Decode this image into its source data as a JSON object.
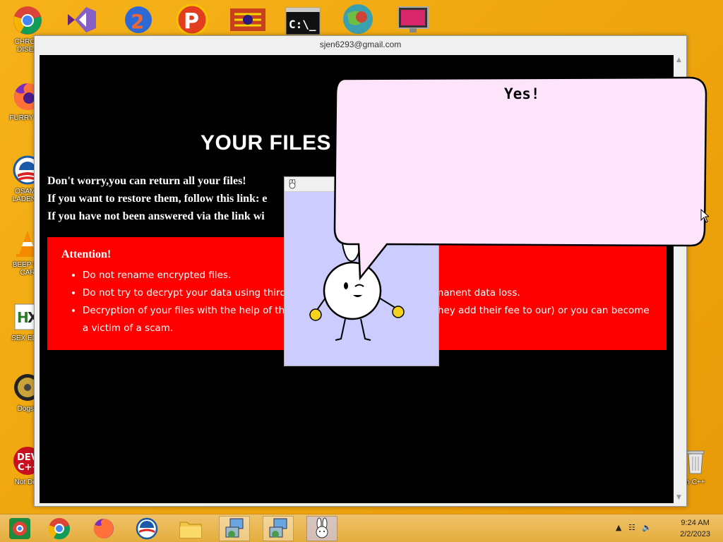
{
  "desktop_icons": [
    {
      "name": "chrome",
      "label": "CHRON\nDISEA"
    },
    {
      "name": "firefox",
      "label": "FURRY CU"
    },
    {
      "name": "obama",
      "label": "OSAMA\nLADEN B"
    },
    {
      "name": "vlc",
      "label": "BEEP BE\nCAR"
    },
    {
      "name": "hex",
      "label": "SEX EDIT"
    },
    {
      "name": "dogshit",
      "label": "Dogsh"
    },
    {
      "name": "devcpp",
      "label": "Not Dog"
    },
    {
      "name": "recycle",
      "label": "n C++"
    }
  ],
  "top_icons": [
    "visual-studio-icon",
    "rain2-icon",
    "p-icon",
    "flag-icon",
    "cmd-icon",
    "earth-icon",
    "monitor-icon"
  ],
  "window": {
    "title": "sjen6293@gmail.com",
    "headline": "YOUR FILES",
    "lines": [
      "Don't worry,you can return all your files!",
      "If you want to restore them, follow this link: e",
      "If you have not been answered via the link wi"
    ],
    "attention_title": "Attention!",
    "attention_items": [
      "Do not rename encrypted files.",
      "Do not try to decrypt your data using third p                                              manent data loss.",
      "Decryption of your files with the help of third                                         e (they add their fee to our) or you can become a victim of a scam."
    ]
  },
  "bubble": {
    "text": "Yes!"
  },
  "taskbar": {
    "items": [
      "chrome-alt",
      "chrome",
      "firefox",
      "obama",
      "explorer",
      "setup1",
      "setup2",
      "bunny"
    ],
    "time": "9:24 AM",
    "date": "2/2/2023"
  },
  "colors": {
    "desktop": "#f0a70f",
    "attention_bg": "#ff0000",
    "bunny_bg": "#ccccff",
    "bubble_bg": "#fde4fb"
  }
}
